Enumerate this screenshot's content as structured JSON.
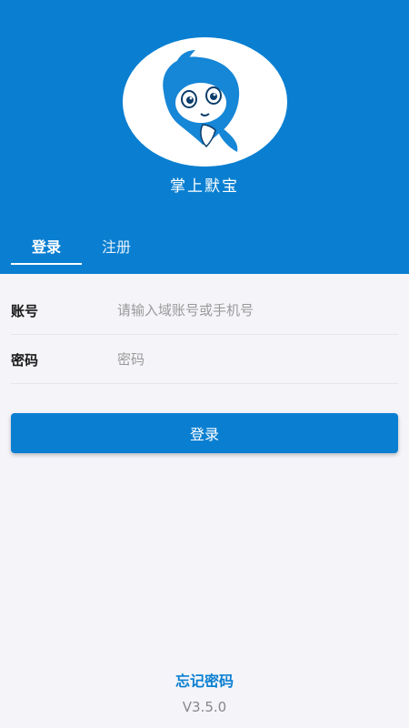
{
  "app": {
    "name": "掌上默宝",
    "logo_icon": "dolphin-mascot-icon"
  },
  "tabs": [
    {
      "label": "登录",
      "active": true
    },
    {
      "label": "注册",
      "active": false
    }
  ],
  "form": {
    "account_label": "账号",
    "account_placeholder": "请输入域账号或手机号",
    "account_value": "",
    "password_label": "密码",
    "password_placeholder": "密码",
    "password_value": ""
  },
  "login_button_label": "登录",
  "forgot_password_label": "忘记密码",
  "version": "V3.5.0",
  "colors": {
    "brand_blue": "#0a7fd1",
    "background": "#f4f4f9"
  }
}
